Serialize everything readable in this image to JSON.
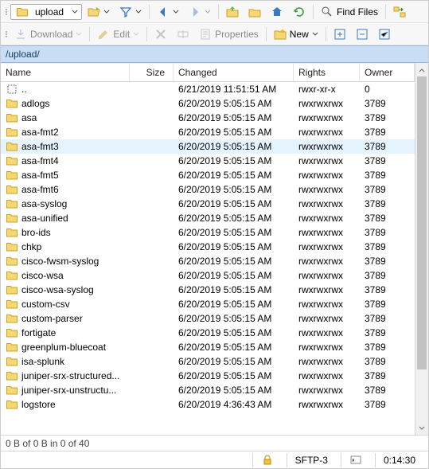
{
  "toolbar1": {
    "address": "upload",
    "findFiles": "Find Files"
  },
  "toolbar2": {
    "download": "Download",
    "edit": "Edit",
    "properties": "Properties",
    "newMenu": "New"
  },
  "path": "/upload/",
  "columns": {
    "name": "Name",
    "size": "Size",
    "changed": "Changed",
    "rights": "Rights",
    "owner": "Owner"
  },
  "rows": [
    {
      "type": "up",
      "name": "..",
      "changed": "6/21/2019 11:51:51 AM",
      "rights": "rwxr-xr-x",
      "owner": "0"
    },
    {
      "type": "dir",
      "name": "adlogs",
      "changed": "6/20/2019 5:05:15 AM",
      "rights": "rwxrwxrwx",
      "owner": "3789"
    },
    {
      "type": "dir",
      "name": "asa",
      "changed": "6/20/2019 5:05:15 AM",
      "rights": "rwxrwxrwx",
      "owner": "3789"
    },
    {
      "type": "dir",
      "name": "asa-fmt2",
      "changed": "6/20/2019 5:05:15 AM",
      "rights": "rwxrwxrwx",
      "owner": "3789"
    },
    {
      "type": "dir",
      "name": "asa-fmt3",
      "changed": "6/20/2019 5:05:15 AM",
      "rights": "rwxrwxrwx",
      "owner": "3789",
      "selected": true
    },
    {
      "type": "dir",
      "name": "asa-fmt4",
      "changed": "6/20/2019 5:05:15 AM",
      "rights": "rwxrwxrwx",
      "owner": "3789"
    },
    {
      "type": "dir",
      "name": "asa-fmt5",
      "changed": "6/20/2019 5:05:15 AM",
      "rights": "rwxrwxrwx",
      "owner": "3789"
    },
    {
      "type": "dir",
      "name": "asa-fmt6",
      "changed": "6/20/2019 5:05:15 AM",
      "rights": "rwxrwxrwx",
      "owner": "3789"
    },
    {
      "type": "dir",
      "name": "asa-syslog",
      "changed": "6/20/2019 5:05:15 AM",
      "rights": "rwxrwxrwx",
      "owner": "3789"
    },
    {
      "type": "dir",
      "name": "asa-unified",
      "changed": "6/20/2019 5:05:15 AM",
      "rights": "rwxrwxrwx",
      "owner": "3789"
    },
    {
      "type": "dir",
      "name": "bro-ids",
      "changed": "6/20/2019 5:05:15 AM",
      "rights": "rwxrwxrwx",
      "owner": "3789"
    },
    {
      "type": "dir",
      "name": "chkp",
      "changed": "6/20/2019 5:05:15 AM",
      "rights": "rwxrwxrwx",
      "owner": "3789"
    },
    {
      "type": "dir",
      "name": "cisco-fwsm-syslog",
      "changed": "6/20/2019 5:05:15 AM",
      "rights": "rwxrwxrwx",
      "owner": "3789"
    },
    {
      "type": "dir",
      "name": "cisco-wsa",
      "changed": "6/20/2019 5:05:15 AM",
      "rights": "rwxrwxrwx",
      "owner": "3789"
    },
    {
      "type": "dir",
      "name": "cisco-wsa-syslog",
      "changed": "6/20/2019 5:05:15 AM",
      "rights": "rwxrwxrwx",
      "owner": "3789"
    },
    {
      "type": "dir",
      "name": "custom-csv",
      "changed": "6/20/2019 5:05:15 AM",
      "rights": "rwxrwxrwx",
      "owner": "3789"
    },
    {
      "type": "dir",
      "name": "custom-parser",
      "changed": "6/20/2019 5:05:15 AM",
      "rights": "rwxrwxrwx",
      "owner": "3789"
    },
    {
      "type": "dir",
      "name": "fortigate",
      "changed": "6/20/2019 5:05:15 AM",
      "rights": "rwxrwxrwx",
      "owner": "3789"
    },
    {
      "type": "dir",
      "name": "greenplum-bluecoat",
      "changed": "6/20/2019 5:05:15 AM",
      "rights": "rwxrwxrwx",
      "owner": "3789"
    },
    {
      "type": "dir",
      "name": "isa-splunk",
      "changed": "6/20/2019 5:05:15 AM",
      "rights": "rwxrwxrwx",
      "owner": "3789"
    },
    {
      "type": "dir",
      "name": "juniper-srx-structured...",
      "changed": "6/20/2019 5:05:15 AM",
      "rights": "rwxrwxrwx",
      "owner": "3789"
    },
    {
      "type": "dir",
      "name": "juniper-srx-unstructu...",
      "changed": "6/20/2019 5:05:15 AM",
      "rights": "rwxrwxrwx",
      "owner": "3789"
    },
    {
      "type": "dir",
      "name": "logstore",
      "changed": "6/20/2019 4:36:43 AM",
      "rights": "rwxrwxrwx",
      "owner": "3789"
    }
  ],
  "status": {
    "summary": "0 B of 0 B in 0 of 40",
    "protocol": "SFTP-3",
    "time": "0:14:30"
  }
}
